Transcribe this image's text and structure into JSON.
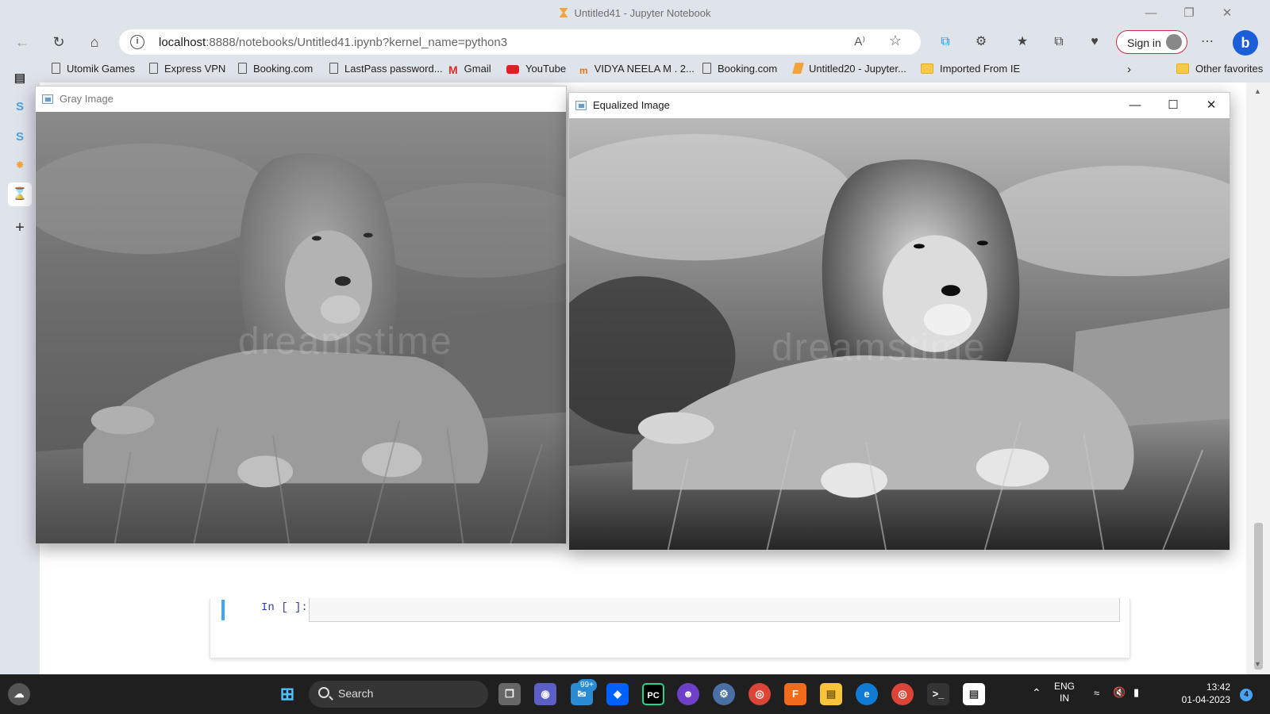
{
  "window": {
    "title": "Untitled41 - Jupyter Notebook"
  },
  "nav": {
    "url_host": "localhost",
    "url_rest": ":8888/notebooks/Untitled41.ipynb?kernel_name=python3",
    "sign_in": "Sign in",
    "read_aloud": "A"
  },
  "favorites": {
    "items": [
      {
        "label": "Utomik Games",
        "icon": "page-icon"
      },
      {
        "label": "Express VPN",
        "icon": "page-icon"
      },
      {
        "label": "Booking.com",
        "icon": "page-icon"
      },
      {
        "label": "LastPass password...",
        "icon": "page-icon"
      },
      {
        "label": "Gmail",
        "icon": "gmail-icon"
      },
      {
        "label": "YouTube",
        "icon": "youtube-icon"
      },
      {
        "label": "VIDYA NEELA M . 2...",
        "icon": "site-logo-icon"
      },
      {
        "label": "Booking.com",
        "icon": "page-icon"
      },
      {
        "label": "Untitled20 - Jupyter...",
        "icon": "jupyter-icon"
      },
      {
        "label": "Imported From IE",
        "icon": "folder-icon"
      }
    ],
    "other": "Other favorites"
  },
  "notebook": {
    "cell_prompt": "In [ ]:"
  },
  "gray_window": {
    "title": "Gray Image",
    "watermark": "dreamstime"
  },
  "equalized_window": {
    "title": "Equalized Image",
    "watermark": "dreamstime"
  },
  "taskbar": {
    "search_label": "Search",
    "mail_badge": "99+",
    "lang_top": "ENG",
    "lang_bottom": "IN",
    "time": "13:42",
    "date": "01-04-2023",
    "notification_count": "4"
  },
  "colors": {
    "accent": "#1c5ed8",
    "signin_border": "#c4314b",
    "cell_bar": "#42a5f5",
    "prompt": "#303f9f"
  }
}
